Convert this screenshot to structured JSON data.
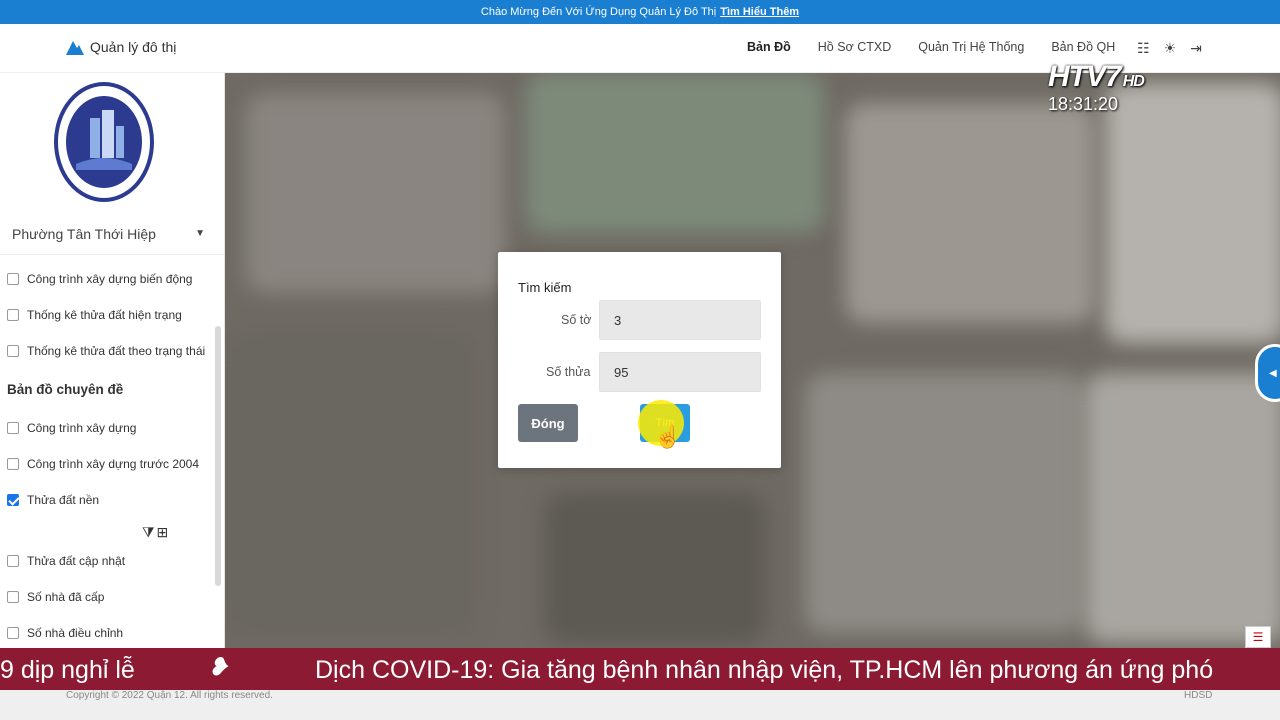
{
  "announcement": {
    "text": "Chào Mừng Đến Với Ứng Dụng Quản Lý Đô Thị",
    "link": "Tìm Hiểu Thêm"
  },
  "nav": {
    "brand": "Quản lý đô thị",
    "items": [
      "Bản Đồ",
      "Hồ Sơ CTXD",
      "Quản Trị Hệ Thống",
      "Bản Đồ QH"
    ],
    "icons": [
      "translate-icon",
      "sun-icon",
      "logout-icon"
    ]
  },
  "sidebar": {
    "ward": "Phường Tân Thới Hiệp",
    "layers_top": [
      {
        "label": "Công trình xây dựng biến động",
        "checked": false
      },
      {
        "label": "Thống kê thửa đất hiện trạng",
        "checked": false
      },
      {
        "label": "Thống kê thửa đất theo trạng thái",
        "checked": false
      }
    ],
    "section_title": "Bản đồ chuyên đề",
    "layers_theme": [
      {
        "label": "Công trình xây dựng",
        "checked": false
      },
      {
        "label": "Công trình xây dựng trước 2004",
        "checked": false
      },
      {
        "label": "Thửa đất nền",
        "checked": true
      },
      {
        "label": "Thửa đất cập nhật",
        "checked": false
      },
      {
        "label": "Số nhà đã cấp",
        "checked": false
      },
      {
        "label": "Số nhà điều chỉnh",
        "checked": false
      }
    ]
  },
  "modal": {
    "title": "Tìm kiếm",
    "sheet_label": "Số tờ",
    "sheet_value": "3",
    "parcel_label": "Số thửa",
    "parcel_value": "95",
    "close_label": "Đóng",
    "search_label": "Tìm"
  },
  "overlay": {
    "channel": "HTV7",
    "channel_hd": "HD",
    "time": "18:31:20"
  },
  "ticker": {
    "left_text": "9 dịp nghỉ lễ",
    "main_text": "Dịch COVID-19: Gia tăng bệnh nhân nhập viện, TP.HCM lên phương án ứng phó"
  },
  "footer": {
    "copyright": "Copyright © 2022 Quận 12. All rights reserved.",
    "hdsd": "HDSD"
  },
  "colors": {
    "primary": "#1b7fd1",
    "ticker_bg": "#8c1a33",
    "button_grey": "#6c757d"
  }
}
